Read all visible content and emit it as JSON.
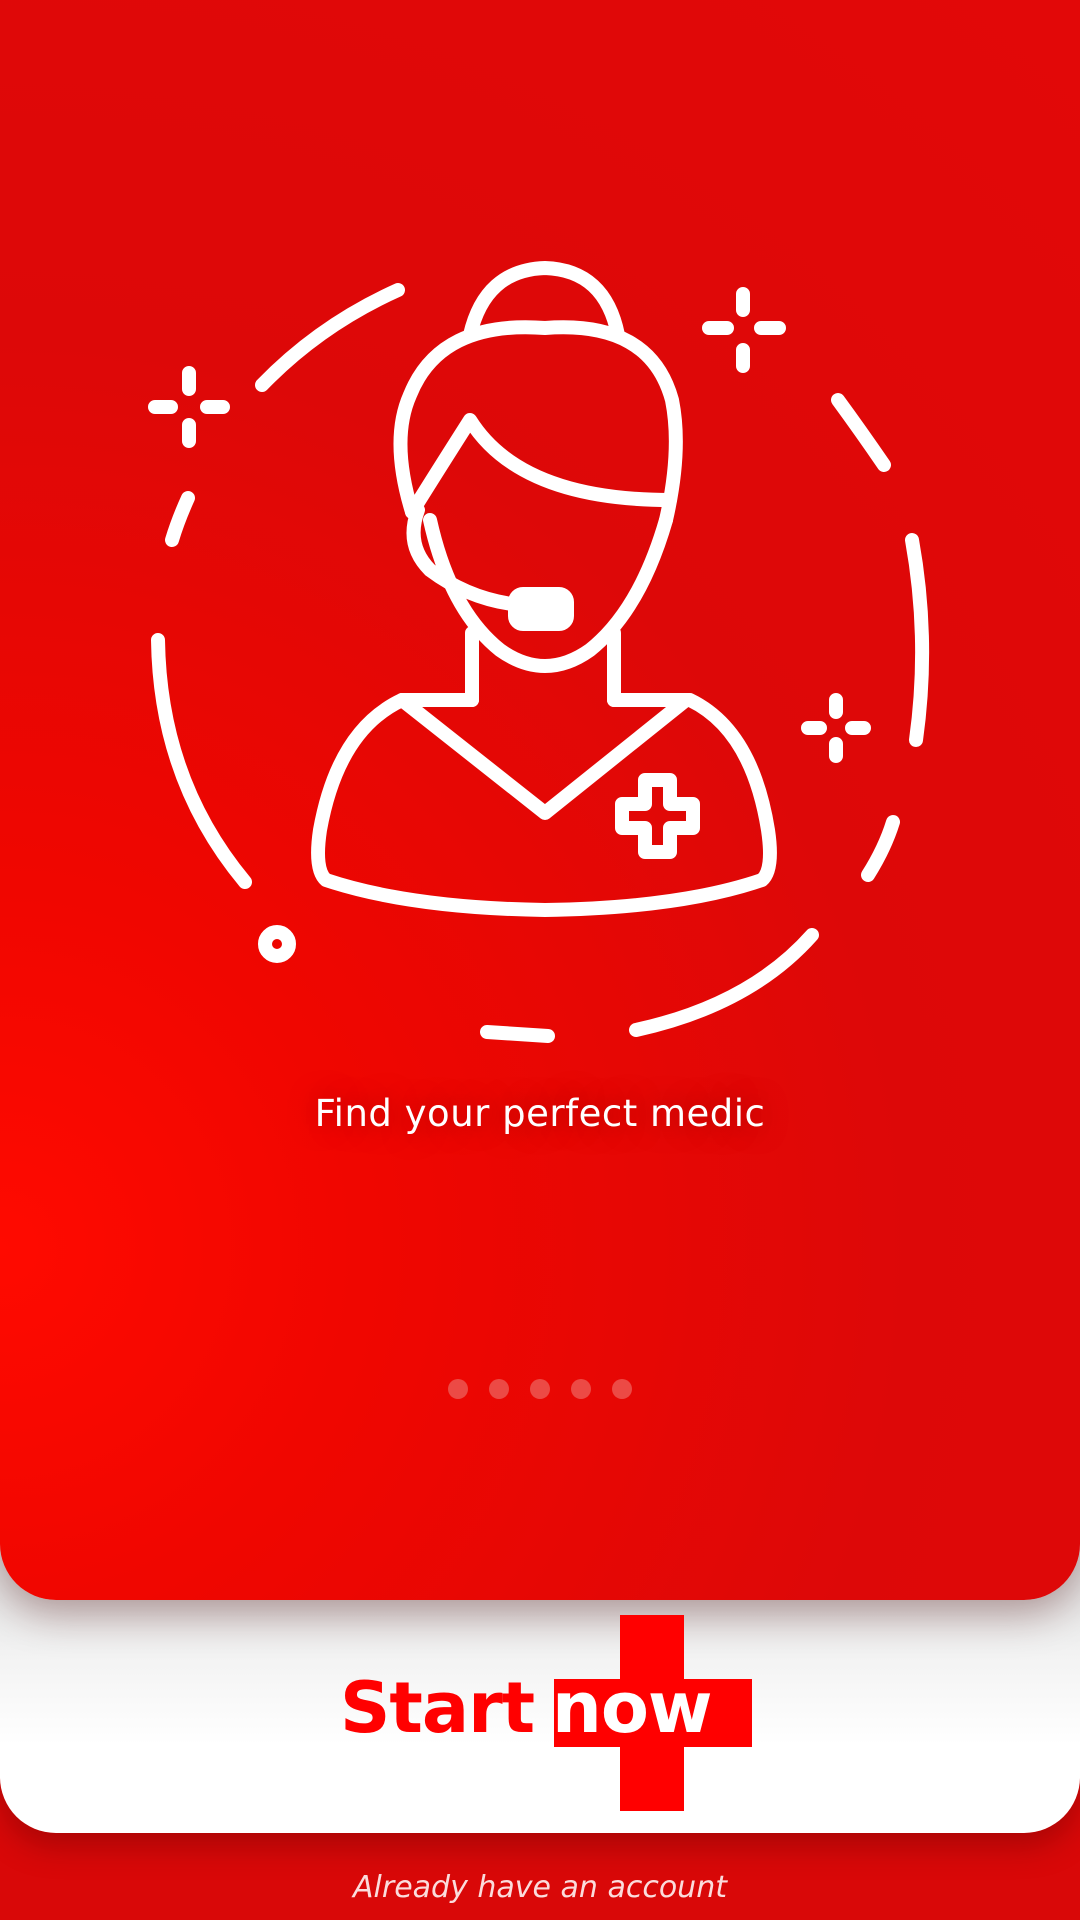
{
  "onboarding": {
    "illustration_icon": "nurse-headset-icon",
    "tagline": "Find your perfect medic",
    "page_count": 5,
    "current_page": 1
  },
  "cta": {
    "start_label": "Start",
    "now_label": "now",
    "login_text": "Already have an account"
  },
  "colors": {
    "brand_red": "#e20808",
    "accent_red": "#ff0000",
    "dot_inactive": "#ec4a45",
    "white": "#ffffff"
  }
}
